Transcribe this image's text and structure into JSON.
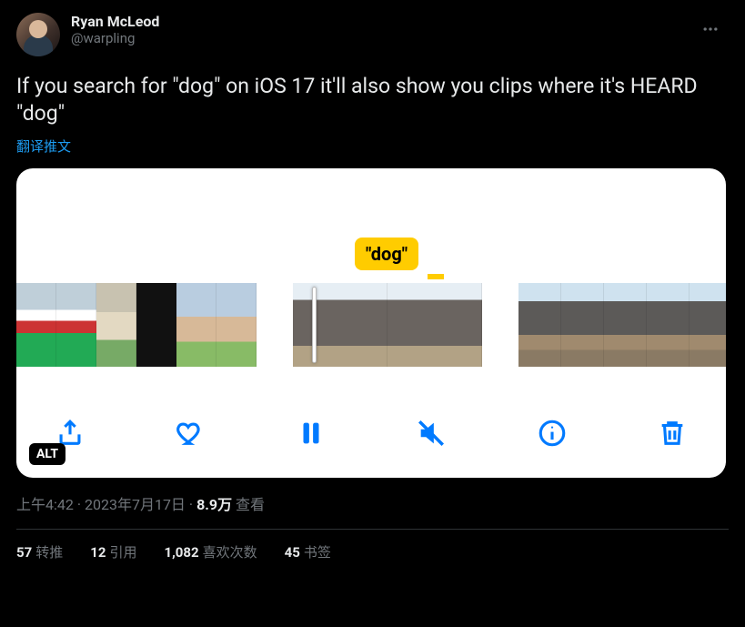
{
  "author": {
    "display_name": "Ryan McLeod",
    "handle": "@warpling"
  },
  "tweet_text": "If you search for \"dog\" on iOS 17 it'll also show you clips where it's HEARD \"dog\"",
  "translate_label": "翻译推文",
  "media": {
    "search_tag": "\"dog\"",
    "alt_badge": "ALT"
  },
  "meta": {
    "time": "上午4:42",
    "sep1": " · ",
    "date": "2023年7月17日",
    "sep2": " · ",
    "views_count": "8.9万",
    "views_label": " 查看"
  },
  "engagement": {
    "retweets_count": "57",
    "retweets_label": "转推",
    "quotes_count": "12",
    "quotes_label": "引用",
    "likes_count": "1,082",
    "likes_label": "喜欢次数",
    "bookmarks_count": "45",
    "bookmarks_label": "书签"
  }
}
